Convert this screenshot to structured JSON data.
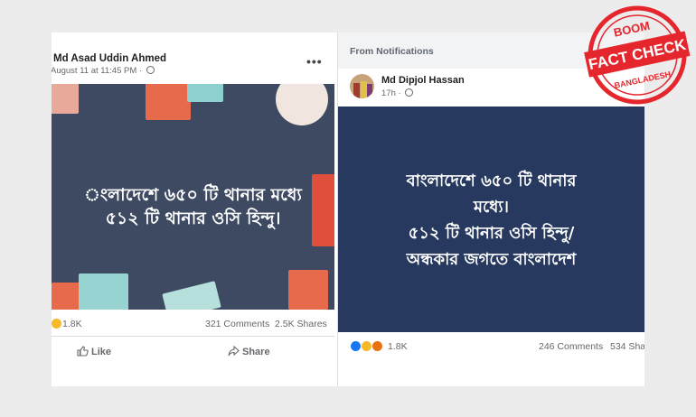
{
  "left_post": {
    "author": "Md Asad Uddin Ahmed",
    "time": "August 11 at 11:45 PM · ",
    "menu": "•••",
    "image_text": [
      "ংলাদেশে ৬৫০ টি থানার মধ্যে",
      "৫১২ টি থানার ওসি হিন্দু।"
    ],
    "reactions_count": "1.8K",
    "comments": "321 Comments",
    "shares": "2.5K Shares",
    "like_label": "Like",
    "share_label": "Share"
  },
  "right_post": {
    "header": "From Notifications",
    "author": "Md Dipjol Hassan",
    "time": "17h · ",
    "image_text": [
      "বাংলাদেশে ৬৫০ টি থানার",
      "মধ্যে।",
      "৫১২ টি থানার ওসি হিন্দু/",
      "অন্ধকার জগতে বাংলাদেশ"
    ],
    "reactions_count": "1.8K",
    "comments": "246 Comments",
    "shares": "534 Sha"
  },
  "badge": {
    "top": "BOOM",
    "main": "FACT CHECK",
    "bottom": "BANGLADESH"
  },
  "colors": {
    "left_bg": "#3d4a62",
    "right_bg": "#27395f",
    "badge_red": "#e5262d"
  }
}
